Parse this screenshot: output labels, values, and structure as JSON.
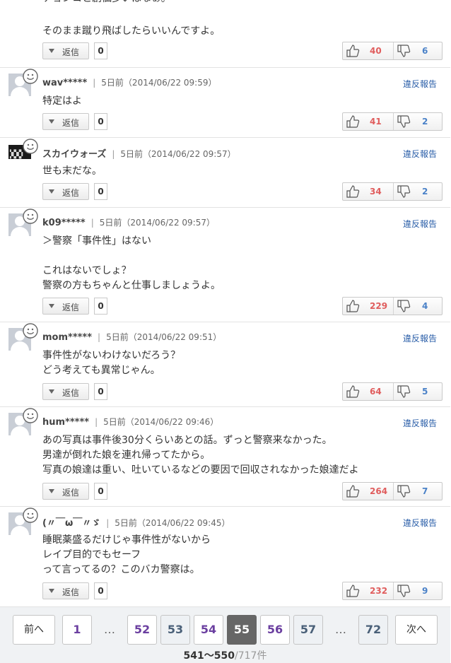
{
  "top_comment": {
    "body_line_cut": "チョンコと創価多いはなぁ。",
    "body_line": "そのまま蹴り飛ばしたらいいんですよ。",
    "reply_label": "返信",
    "reply_count": "0",
    "up": "40",
    "down": "6"
  },
  "comments": [
    {
      "user": "wav*****",
      "time": "5日前（2014/06/22 09:59）",
      "body": "特定はよ",
      "reply_label": "返信",
      "reply_count": "0",
      "up": "41",
      "down": "2",
      "report": "違反報告"
    },
    {
      "user": "スカイウォーズ",
      "time": "5日前（2014/06/22 09:57）",
      "body": "世も末だな。",
      "reply_label": "返信",
      "reply_count": "0",
      "up": "34",
      "down": "2",
      "report": "違反報告"
    },
    {
      "user": "k09*****",
      "time": "5日前（2014/06/22 09:57）",
      "body": "＞警察「事件性」はない\n\nこれはないでしょ？\n警察の方もちゃんと仕事しましょうよ。",
      "reply_label": "返信",
      "reply_count": "0",
      "up": "229",
      "down": "4",
      "report": "違反報告"
    },
    {
      "user": "mom*****",
      "time": "5日前（2014/06/22 09:51）",
      "body": "事件性がないわけないだろう？\nどう考えても異常じゃん。",
      "reply_label": "返信",
      "reply_count": "0",
      "up": "64",
      "down": "5",
      "report": "違反報告"
    },
    {
      "user": "hum*****",
      "time": "5日前（2014/06/22 09:46）",
      "body": "あの写真は事件後30分くらいあとの話。ずっと警察来なかった。\n男達が倒れた娘を連れ帰ってたから。\n写真の娘達は重い、吐いているなどの要因で回収されなかった娘達だよ",
      "reply_label": "返信",
      "reply_count": "0",
      "up": "264",
      "down": "7",
      "report": "違反報告"
    },
    {
      "user": "(〃￣ω￣〃ゞ",
      "time": "5日前（2014/06/22 09:45）",
      "body": "睡眠薬盛るだけじゃ事件性がないから\nレイプ目的でもセーフ\nって言ってるの？このバカ警察は。",
      "reply_label": "返信",
      "reply_count": "0",
      "up": "232",
      "down": "9",
      "report": "違反報告"
    }
  ],
  "pagination": {
    "prev": "前へ",
    "next": "次へ",
    "ellipsis": "…",
    "pages": [
      "1",
      "52",
      "53",
      "54",
      "55",
      "56",
      "57",
      "72"
    ],
    "current": "55",
    "range": "541～550",
    "total": "/717件"
  }
}
